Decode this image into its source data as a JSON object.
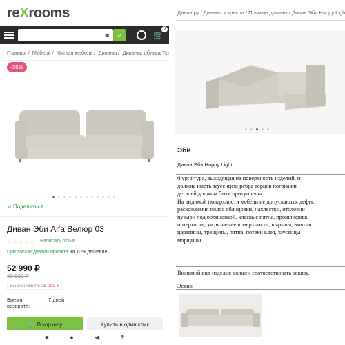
{
  "brand": {
    "logo_pre": "re",
    "logo_x": "X",
    "logo_post": "rooms"
  },
  "search": {
    "placeholder": ""
  },
  "cart": {
    "count": "0"
  },
  "breadcrumbs_left": [
    "Главная",
    "Мебель",
    "Мягкая мебель",
    "Диваны",
    "Диваны, обивка Ткань"
  ],
  "discount_badge": "-35%",
  "share_label": "Поделиться",
  "product": {
    "title": "Диван Эби Alfa Велюр 03",
    "stars": "☆☆☆☆☆",
    "review_link": "Написать отзыв",
    "promo_prefix": "При заказе дизайн-проекта",
    "promo_suffix": " на 10% дешевле",
    "price": "52 990 ₽",
    "old_price": "80 990 ₽",
    "save_prefix": "Вы экономите: ",
    "save_amount": "28 000 ₽",
    "return_label": "Время возврата:",
    "return_value": "7 дней",
    "add_to_cart": "В корзину",
    "one_click": "Купить в один клик"
  },
  "gallery": {
    "total_dots": 12,
    "active_dot": 0
  },
  "nav_icons": [
    "stop-icon",
    "home-icon",
    "back-icon",
    "accessibility-icon"
  ],
  "breadcrumbs_right": [
    "Диван.ру",
    "Диваны и кресла",
    "Прямые диваны",
    "Диван Эби Happy Light"
  ],
  "doc": {
    "title": "Эби",
    "subtitle": "Диван Эби Happy Light",
    "lines": [
      "Фурнитура, выходящая на поверхность изделий, н",
      "должна иметь заусенцев; ребра торцов погонажн",
      "деталей должны быть притуплены.",
      "На видимой поверхности мебели не допускаются дефект",
      "расхождения полос облицовки, нахлестки, отслоени",
      "пузыри под облицовкой, клеевые пятна, прошлифовк",
      "потертость, загрязнение поверхности, вырывы, вмятин",
      "царапины, трещины, пятна, потеки клея, заусенцы",
      "морщины."
    ],
    "appearance_line": "Внешний вид изделия должен соответствовать эскизу.",
    "sketch_label": "Эскиз:"
  },
  "colors": {
    "accent_green": "#7cc242",
    "discount_pink": "#e2557a",
    "dark_bar": "#2b2b2b"
  }
}
